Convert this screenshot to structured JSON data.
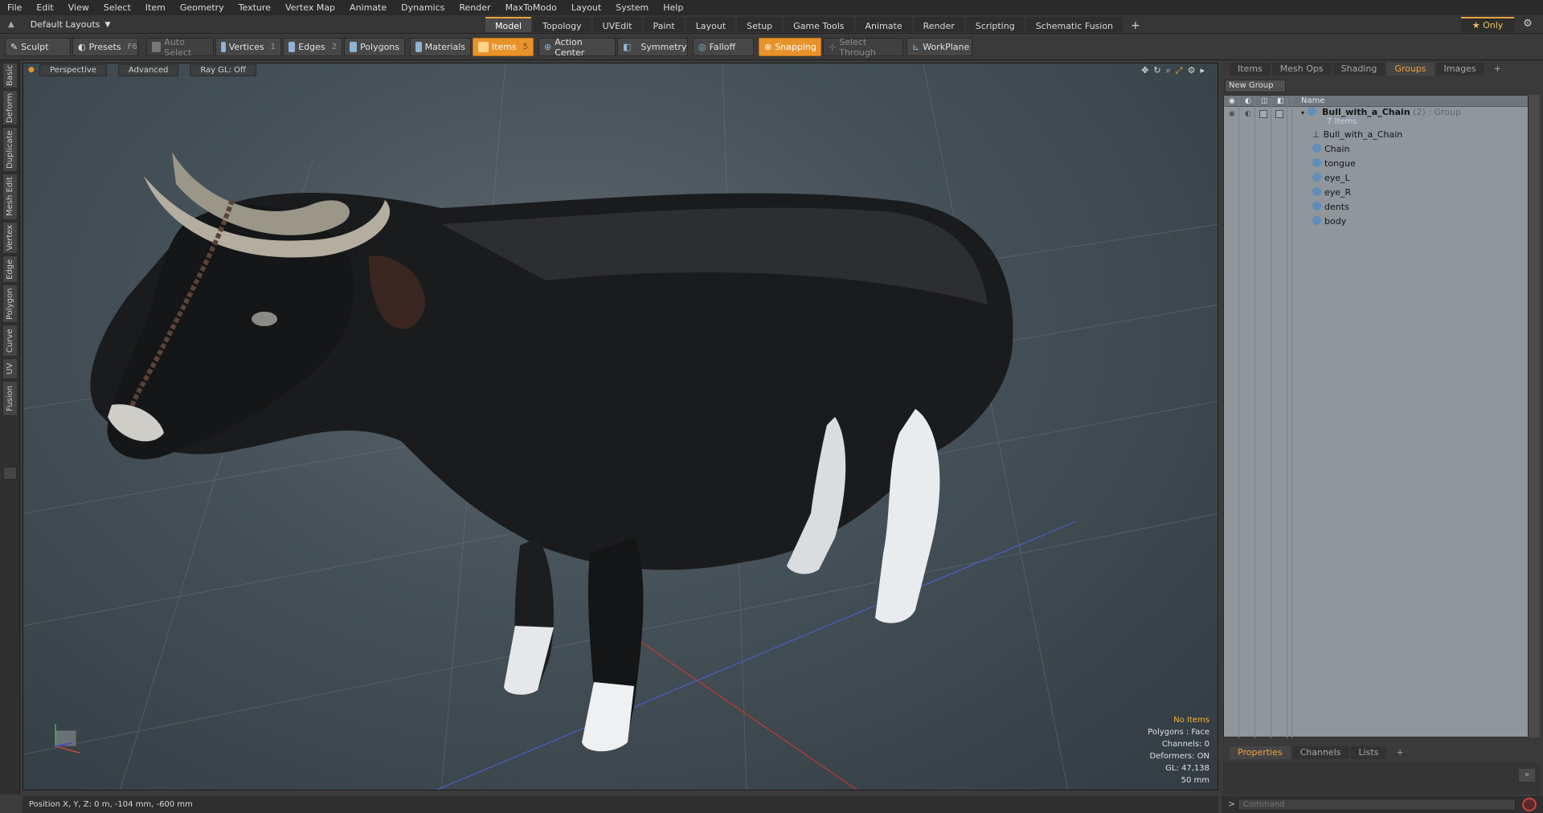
{
  "menu": [
    "File",
    "Edit",
    "View",
    "Select",
    "Item",
    "Geometry",
    "Texture",
    "Vertex Map",
    "Animate",
    "Dynamics",
    "Render",
    "MaxToModo",
    "Layout",
    "System",
    "Help"
  ],
  "layout_selector": {
    "label": "Default Layouts"
  },
  "mode_tabs": [
    {
      "label": "Model",
      "active": true
    },
    {
      "label": "Topology"
    },
    {
      "label": "UVEdit"
    },
    {
      "label": "Paint"
    },
    {
      "label": "Layout"
    },
    {
      "label": "Setup"
    },
    {
      "label": "Game Tools"
    },
    {
      "label": "Animate"
    },
    {
      "label": "Render"
    },
    {
      "label": "Scripting"
    },
    {
      "label": "Schematic Fusion"
    }
  ],
  "mode_add": "+",
  "only_button": "Only",
  "toolbar": {
    "sculpt": "Sculpt",
    "presets": "Presets",
    "presets_key": "F6",
    "auto_select": "Auto Select",
    "vertices": "Vertices",
    "vertices_key": "1",
    "edges": "Edges",
    "edges_key": "2",
    "polygons": "Polygons",
    "materials": "Materials",
    "items": "Items",
    "items_key": "5",
    "action_center": "Action Center",
    "symmetry": "Symmetry",
    "falloff": "Falloff",
    "snapping": "Snapping",
    "select_through": "Select Through",
    "workplane": "WorkPlane"
  },
  "left_tabs": [
    "Basic",
    "Deform",
    "Duplicate",
    "Mesh Edit",
    "Vertex",
    "Edge",
    "Polygon",
    "Curve",
    "UV",
    "Fusion"
  ],
  "viewport": {
    "header": [
      "Perspective",
      "Advanced",
      "Ray GL: Off"
    ],
    "info": [
      "No Items",
      "Polygons : Face",
      "Channels: 0",
      "Deformers: ON",
      "GL: 47,138",
      "50 mm"
    ],
    "accent": "#f0b040"
  },
  "status": "Position X, Y, Z:  0 m, -104 mm, -600 mm",
  "right_tabs": [
    {
      "label": "Items"
    },
    {
      "label": "Mesh Ops"
    },
    {
      "label": "Shading"
    },
    {
      "label": "Groups",
      "active": true
    },
    {
      "label": "Images"
    }
  ],
  "right_add": "+",
  "new_group": "New Group",
  "tree": {
    "column_name": "Name",
    "group": {
      "name": "Bull_with_a_Chain",
      "count": "(2)",
      "type": ": Group",
      "items_label": "7 Items"
    },
    "children": [
      "Bull_with_a_Chain",
      "Chain",
      "tongue",
      "eye_L",
      "eye_R",
      "dents",
      "body"
    ]
  },
  "props_tabs": [
    {
      "label": "Properties",
      "active": true
    },
    {
      "label": "Channels"
    },
    {
      "label": "Lists"
    }
  ],
  "props_add": "+",
  "command": {
    "prompt": ">",
    "placeholder": "Command"
  }
}
